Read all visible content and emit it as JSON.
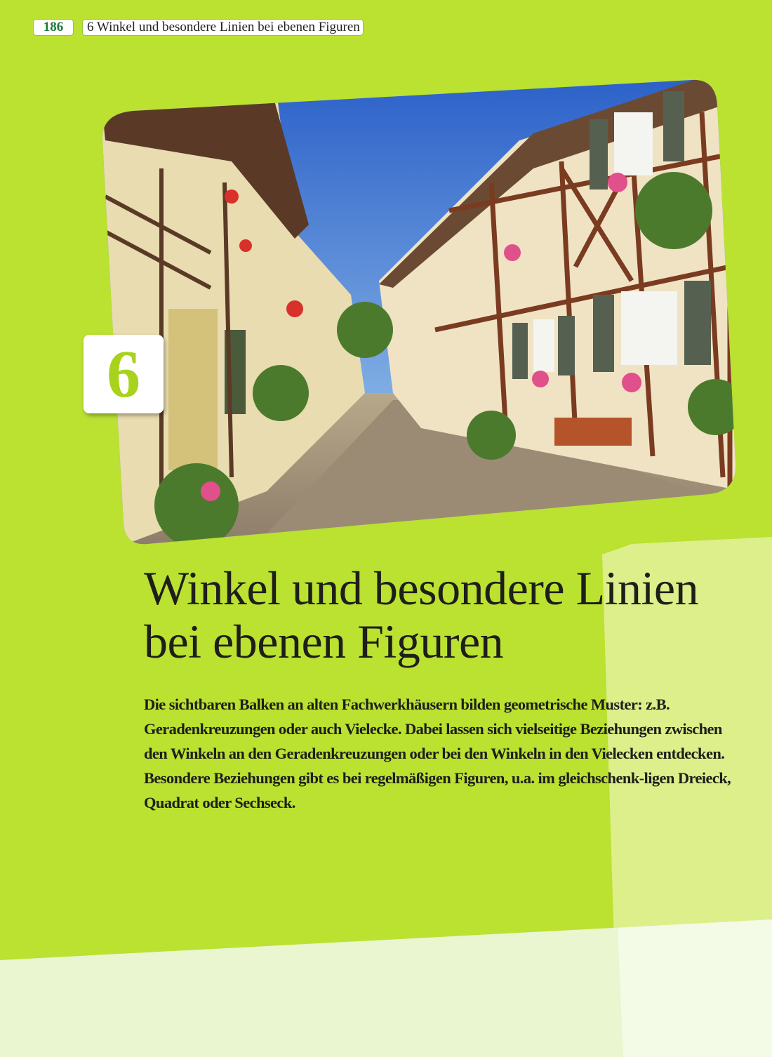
{
  "header": {
    "page_number": "186",
    "running_head": "6  Winkel und besondere Linien bei ebenen Figuren"
  },
  "chapter": {
    "number": "6",
    "title_line1": "Winkel und besondere Linien",
    "title_line2": "bei ebenen Figuren",
    "intro_paragraph1": "Die sichtbaren Balken an alten Fachwerkhäusern bilden geometrische Muster: z.B. Geradenkreuzungen oder  auch Vielecke. Dabei lassen sich vielseitige Beziehungen zwischen den Winkeln an den Geradenkreuzungen oder bei den Winkeln in den Vielecken entdecken.",
    "intro_paragraph2": "Besondere Beziehungen gibt es bei regelmäßigen Figuren, u.a. im gleichschenk-ligen Dreieck, Quadrat oder Sechseck."
  },
  "colors": {
    "page_green": "#bbe131",
    "panel_light": "#dcef8a",
    "bottom_band": "#e9f6d0",
    "chapter_number": "#a8d21c",
    "page_number": "#1f7a3a"
  }
}
